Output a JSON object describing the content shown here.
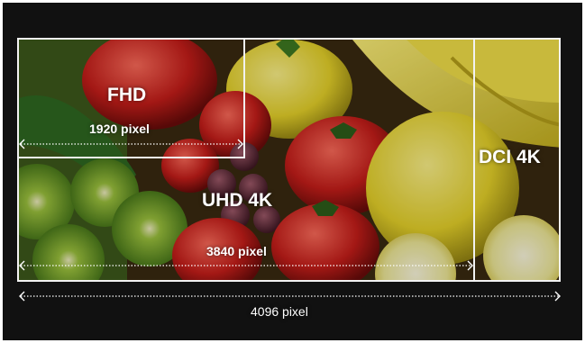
{
  "labels": {
    "fhd": "FHD",
    "fhd_width": "1920 pixel",
    "uhd": "UHD 4K",
    "uhd_width": "3840 pixel",
    "dci": "DCI 4K",
    "dci_width": "4096 pixel"
  },
  "colors": {
    "frame": "#111111",
    "outline": "#f2f2f2",
    "text": "#ffffff"
  }
}
